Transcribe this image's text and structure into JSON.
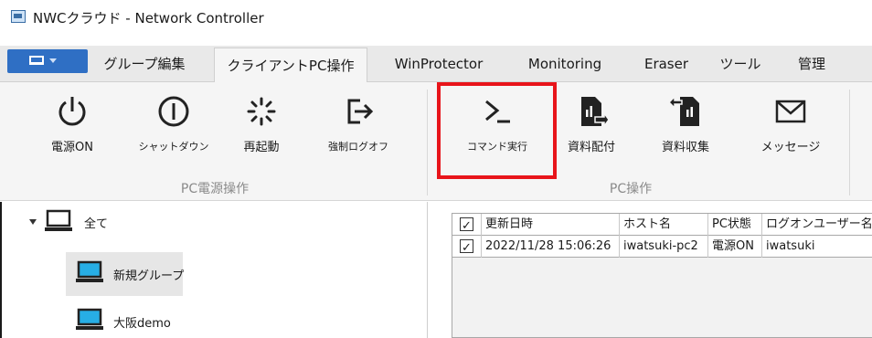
{
  "window": {
    "title": "NWCクラウド - Network Controller"
  },
  "tabs": [
    {
      "label": "グループ編集"
    },
    {
      "label": "クライアントPC操作",
      "active": true
    },
    {
      "label": "WinProtector"
    },
    {
      "label": "Monitoring"
    },
    {
      "label": "Eraser"
    },
    {
      "label": "ツール"
    },
    {
      "label": "管理"
    }
  ],
  "ribbon": {
    "power_group": {
      "label": "PC電源操作",
      "buttons": [
        {
          "label": "電源ON",
          "icon": "power-icon"
        },
        {
          "label": "シャットダウン",
          "icon": "shutdown-icon"
        },
        {
          "label": "再起動",
          "icon": "restart-icon"
        },
        {
          "label": "強制ログオフ",
          "icon": "logoff-icon"
        }
      ]
    },
    "pc_group": {
      "label": "PC操作",
      "buttons": [
        {
          "label": "コマンド実行",
          "icon": "command-prompt-icon",
          "highlighted": true
        },
        {
          "label": "資料配付",
          "icon": "distribute-file-icon"
        },
        {
          "label": "資料収集",
          "icon": "collect-file-icon"
        },
        {
          "label": "メッセージ",
          "icon": "mail-icon"
        }
      ]
    }
  },
  "tree": {
    "root": {
      "label": "全て"
    },
    "children": [
      {
        "label": "新規グループ",
        "selected": true
      },
      {
        "label": "大阪demo"
      }
    ]
  },
  "grid": {
    "headers": [
      "更新日時",
      "ホスト名",
      "PC状態",
      "ログオンユーザー名"
    ],
    "rows": [
      {
        "checked": true,
        "cells": [
          "2022/11/28 15:06:26",
          "iwatsuki-pc2",
          "電源ON",
          "iwatsuki"
        ]
      }
    ]
  },
  "colors": {
    "accent": "#2f6fc4",
    "highlight": "#e8141a",
    "group_label": "#8a8a8a"
  }
}
